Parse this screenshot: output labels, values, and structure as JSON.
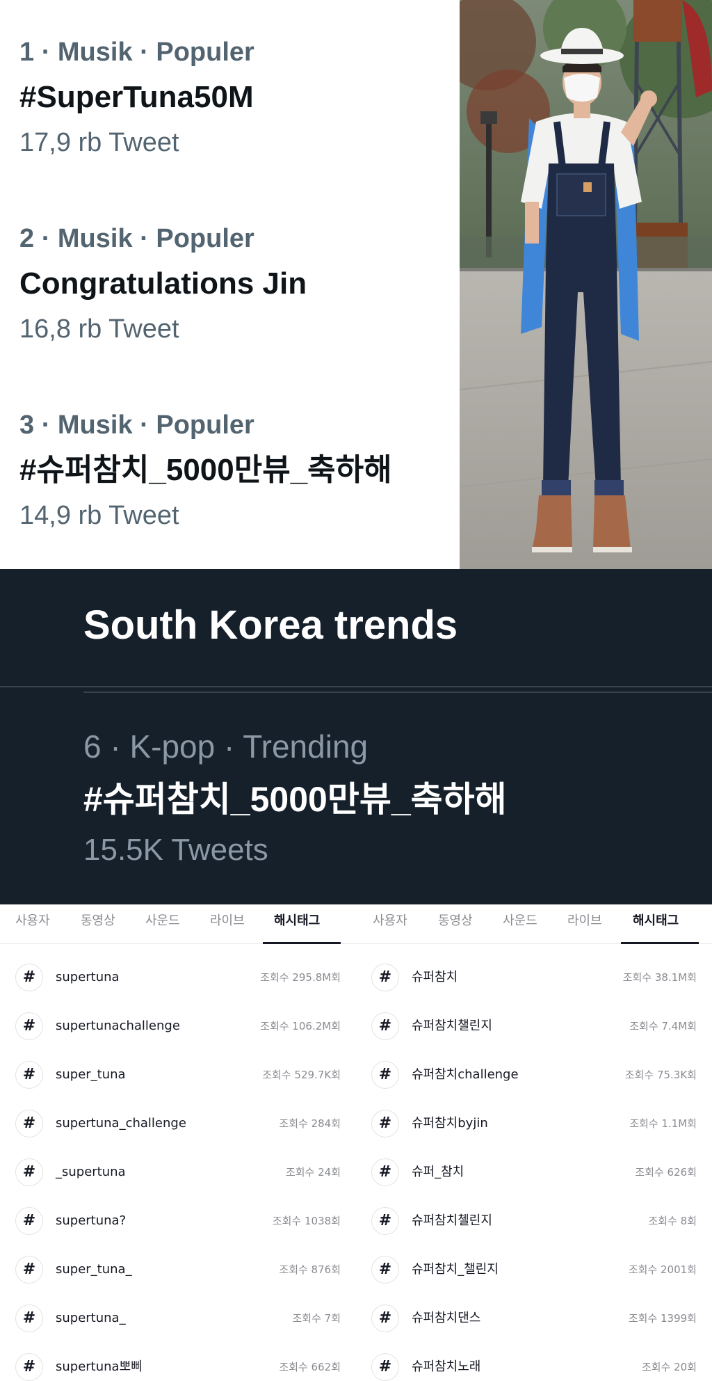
{
  "id_trends": [
    {
      "meta": "1 · Musik · Populer",
      "name": "#SuperTuna50M",
      "count": "17,9 rb Tweet"
    },
    {
      "meta": "2 · Musik · Populer",
      "name": "Congratulations Jin",
      "count": "16,8 rb Tweet"
    },
    {
      "meta": "3 · Musik · Populer",
      "name": "#슈퍼참치_5000만뷰_축하해",
      "count": "14,9 rb Tweet"
    }
  ],
  "kr_trends": {
    "title": "South Korea trends",
    "item": {
      "meta": "6 · K-pop · Trending",
      "name": "#슈퍼참치_5000만뷰_축하해",
      "count": "15.5K Tweets"
    }
  },
  "tiktok_left": {
    "tabs": [
      "사용자",
      "동영상",
      "사운드",
      "라이브",
      "해시태그"
    ],
    "active_tab": "해시태그",
    "rows": [
      {
        "tag": "supertuna",
        "views": "조회수 295.8M회"
      },
      {
        "tag": "supertunachallenge",
        "views": "조회수 106.2M회"
      },
      {
        "tag": "super_tuna",
        "views": "조회수 529.7K회"
      },
      {
        "tag": "supertuna_challenge",
        "views": "조회수 284회"
      },
      {
        "tag": "_supertuna",
        "views": "조회수 24회"
      },
      {
        "tag": "supertuna?",
        "views": "조회수 1038회"
      },
      {
        "tag": "super_tuna_",
        "views": "조회수 876회"
      },
      {
        "tag": "supertuna_",
        "views": "조회수 7회"
      },
      {
        "tag": "supertuna뽀삐",
        "views": "조회수 662회"
      }
    ]
  },
  "tiktok_right": {
    "tabs": [
      "사용자",
      "동영상",
      "사운드",
      "라이브",
      "해시태그"
    ],
    "active_tab": "해시태그",
    "rows": [
      {
        "tag": "슈퍼참치",
        "views": "조회수 38.1M회"
      },
      {
        "tag": "슈퍼참치챌린지",
        "views": "조회수 7.4M회"
      },
      {
        "tag": "슈퍼참치challenge",
        "views": "조회수 75.3K회"
      },
      {
        "tag": "슈퍼참치byjin",
        "views": "조회수 1.1M회"
      },
      {
        "tag": "슈퍼_참치",
        "views": "조회수 626회"
      },
      {
        "tag": "슈퍼참치첼린지",
        "views": "조회수 8회"
      },
      {
        "tag": "슈퍼참치_챌린지",
        "views": "조회수 2001회"
      },
      {
        "tag": "슈퍼참치댄스",
        "views": "조회수 1399회"
      },
      {
        "tag": "슈퍼참치노래",
        "views": "조회수 20회"
      }
    ]
  },
  "icons": {
    "hashtag": "hashtag-icon"
  },
  "colors": {
    "twitter_dim_bg": "#15202b",
    "twitter_secondary": "#536471",
    "tiktok_text": "#161823",
    "tiktok_secondary": "#8a8b91"
  }
}
